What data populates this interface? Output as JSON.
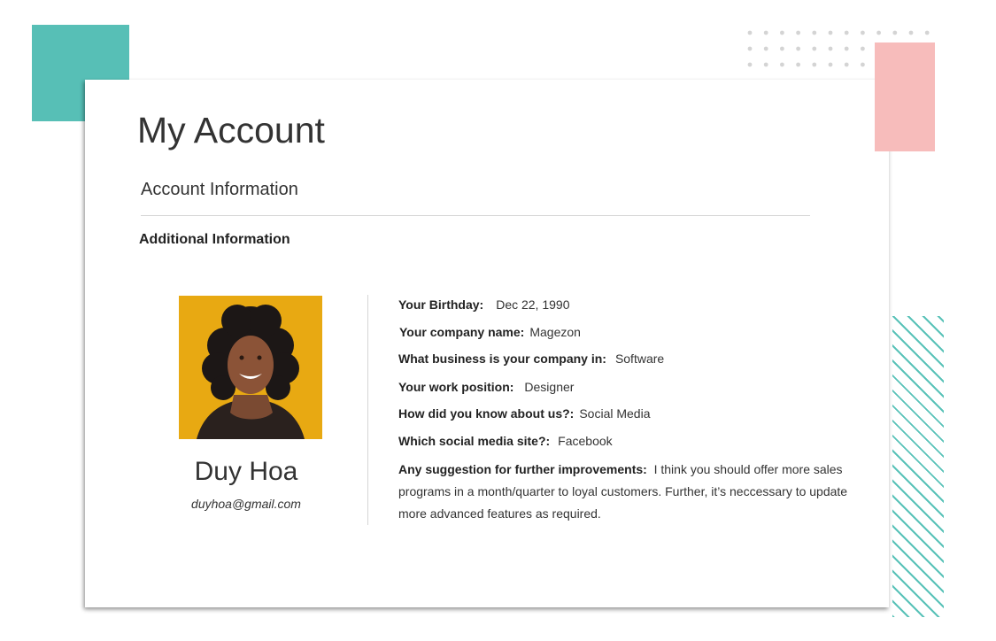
{
  "header": {
    "title": "My Account"
  },
  "section": {
    "title": "Account Information",
    "subtitle": "Additional Information"
  },
  "profile": {
    "name": "Duy Hoa",
    "email": "duyhoa@gmail.com",
    "photo": "portrait-photo"
  },
  "details": [
    {
      "label": "Your Birthday:",
      "value": "Dec 22, 1990"
    },
    {
      "label": "Your company name:",
      "value": "Magezon"
    },
    {
      "label": "What business is your company in:",
      "value": "Software"
    },
    {
      "label": "Your work position:",
      "value": "Designer"
    },
    {
      "label": "How did you know about us?:",
      "value": "Social Media"
    },
    {
      "label": "Which social media site?:",
      "value": "Facebook"
    },
    {
      "label": "Any suggestion for further improvements:",
      "value": "I think you should offer more sales programs in a month/quarter to loyal customers. Further, it’s neccessary to update more advanced features as required."
    }
  ],
  "colors": {
    "teal": "#57bfb6",
    "pink": "#f7bcbb",
    "photo_bg": "#e8a912"
  }
}
